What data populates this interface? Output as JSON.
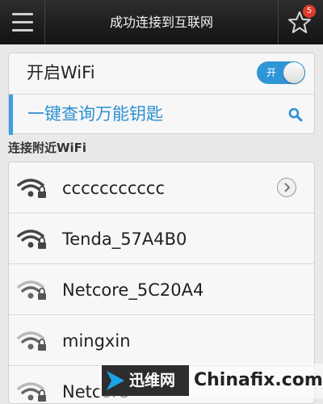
{
  "header": {
    "title": "成功连接到互联网",
    "favorites_badge": "5"
  },
  "wifi_switch": {
    "label": "开启WiFi",
    "toggle_text": "开",
    "enabled": true
  },
  "key_search": {
    "label": "一键查询万能钥匙"
  },
  "nearby": {
    "section_title": "连接附近WiFi",
    "networks": [
      {
        "ssid": "ccccccccccc",
        "signal": "strong",
        "locked": true,
        "has_detail": true
      },
      {
        "ssid": "Tenda_57A4B0",
        "signal": "strong",
        "locked": true,
        "has_detail": false
      },
      {
        "ssid": "Netcore_5C20A4",
        "signal": "medium",
        "locked": true,
        "has_detail": false
      },
      {
        "ssid": "mingxin",
        "signal": "medium",
        "locked": true,
        "has_detail": false
      },
      {
        "ssid": "Netcore",
        "signal": "medium",
        "locked": true,
        "has_detail": false
      }
    ]
  },
  "watermark": {
    "logo_text": "迅维网",
    "site": "Chinafix.com"
  },
  "colors": {
    "accent": "#2f96d6",
    "topbar": "#1e1e1e",
    "badge": "#e23b2e"
  }
}
